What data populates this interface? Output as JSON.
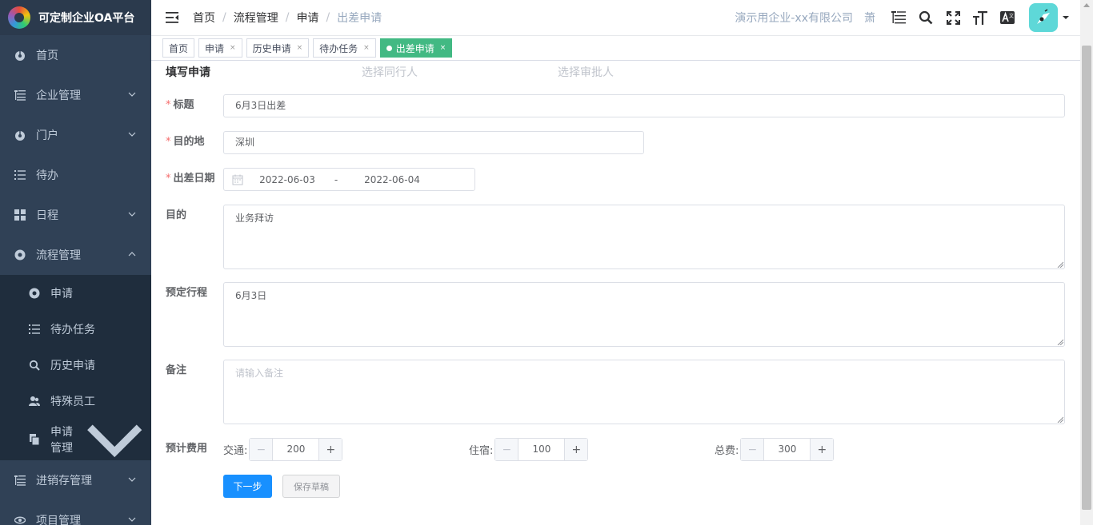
{
  "app": {
    "title": "可定制企业OA平台"
  },
  "sidebar": {
    "items": [
      {
        "label": "首页",
        "icon": "dashboard-icon"
      },
      {
        "label": "企业管理",
        "icon": "tree-table-icon",
        "expandable": true
      },
      {
        "label": "门户",
        "icon": "dashboard-icon",
        "expandable": true
      },
      {
        "label": "待办",
        "icon": "list-icon"
      },
      {
        "label": "日程",
        "icon": "grid-icon",
        "expandable": true
      },
      {
        "label": "流程管理",
        "icon": "clover-icon",
        "expanded": true
      }
    ],
    "subitems": [
      {
        "label": "申请",
        "icon": "clover-icon"
      },
      {
        "label": "待办任务",
        "icon": "list-icon"
      },
      {
        "label": "历史申请",
        "icon": "search-icon"
      },
      {
        "label": "特殊员工",
        "icon": "peoples-icon"
      },
      {
        "label": "申请管理",
        "icon": "documents-icon",
        "expandable": true
      }
    ],
    "bottom_items": [
      {
        "label": "进销存管理",
        "icon": "tree-table-icon",
        "expandable": true
      },
      {
        "label": "项目管理",
        "icon": "eye-icon",
        "expandable": true
      }
    ]
  },
  "breadcrumb": [
    "首页",
    "流程管理",
    "申请",
    "出差申请"
  ],
  "header": {
    "company": "演示用企业-xx有限公司",
    "user": "萧"
  },
  "tags": [
    {
      "label": "首页",
      "closable": false
    },
    {
      "label": "申请",
      "closable": true
    },
    {
      "label": "历史申请",
      "closable": true
    },
    {
      "label": "待办任务",
      "closable": true
    },
    {
      "label": "出差申请",
      "closable": true,
      "active": true
    }
  ],
  "steps": [
    "填写申请",
    "选择同行人",
    "选择审批人"
  ],
  "form": {
    "title": {
      "label": "标题",
      "value": "6月3日出差",
      "required": true
    },
    "destination": {
      "label": "目的地",
      "value": "深圳",
      "required": true
    },
    "dates": {
      "label": "出差日期",
      "start": "2022-06-03",
      "separator": "-",
      "end": "2022-06-04",
      "required": true
    },
    "purpose": {
      "label": "目的",
      "value": "业务拜访"
    },
    "itinerary": {
      "label": "预定行程",
      "value": "6月3日"
    },
    "remark": {
      "label": "备注",
      "value": "",
      "placeholder": "请输入备注"
    },
    "expense": {
      "label": "预计费用",
      "transport": {
        "label": "交通:",
        "value": "200"
      },
      "lodging": {
        "label": "住宿:",
        "value": "100"
      },
      "total": {
        "label": "总费:",
        "value": "300"
      }
    }
  },
  "actions": {
    "next": "下一步",
    "save_draft": "保存草稿"
  },
  "colors": {
    "sidebar": "#304156",
    "submenu": "#1f2d3d",
    "active_tag": "#42b983",
    "primary": "#1890ff",
    "avatar": "#5ed8d8"
  }
}
